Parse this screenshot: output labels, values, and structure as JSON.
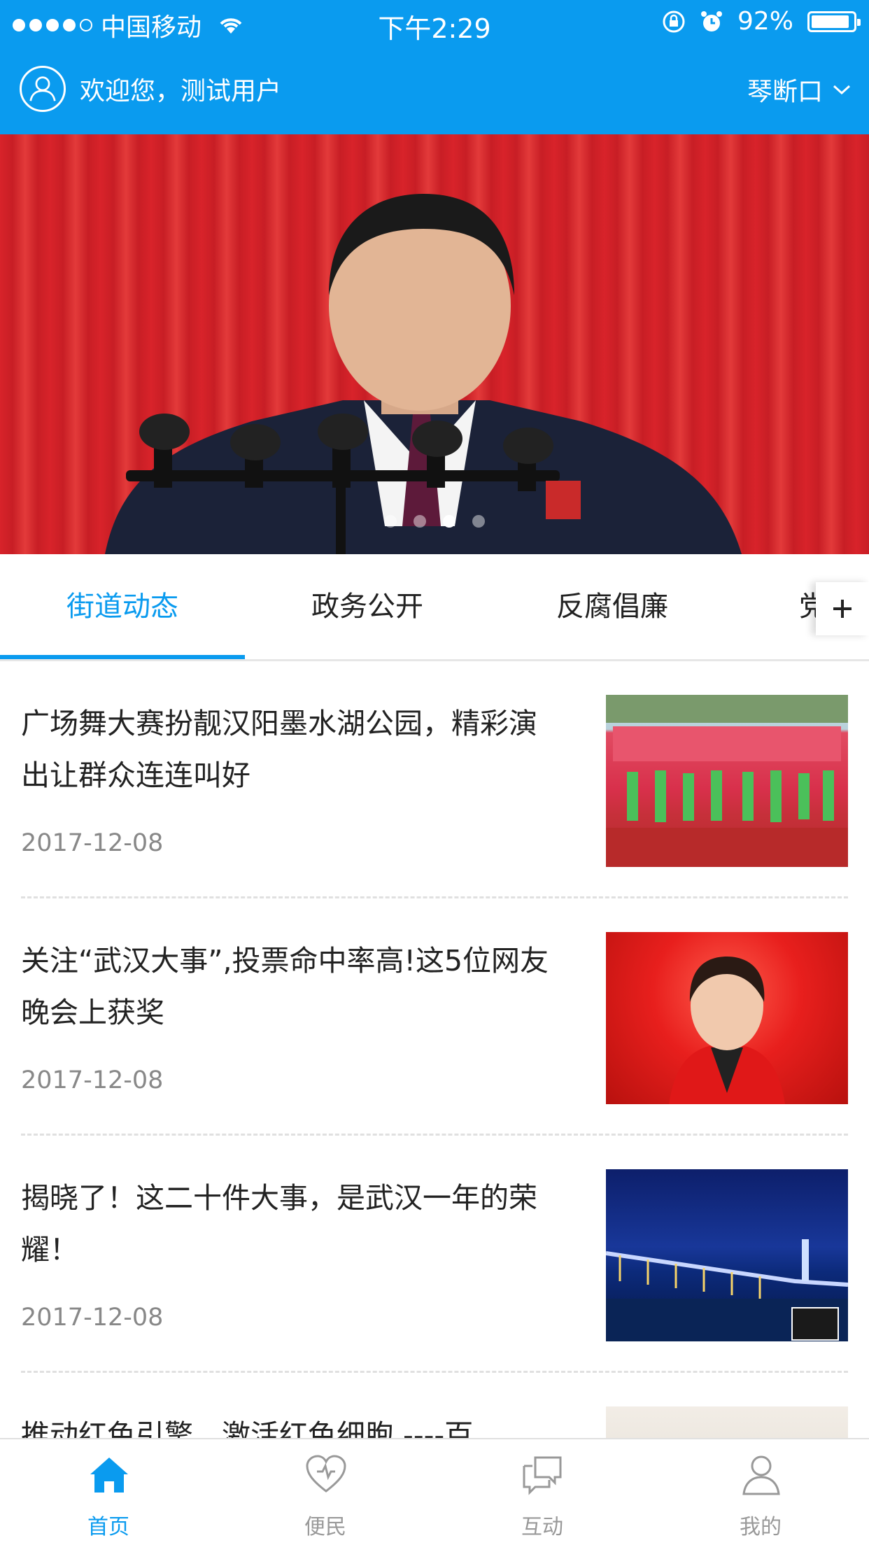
{
  "status_bar": {
    "carrier": "中国移动",
    "time": "下午2:29",
    "battery": "92%",
    "battery_level": 0.92
  },
  "header": {
    "welcome": "欢迎您，测试用户",
    "location": "琴断口"
  },
  "banner": {
    "slide_count": 4,
    "active_slide": 3
  },
  "tabs": [
    {
      "label": "街道动态",
      "active": true
    },
    {
      "label": "政务公开",
      "active": false
    },
    {
      "label": "反腐倡廉",
      "active": false
    },
    {
      "label": "党",
      "active": false
    }
  ],
  "news": [
    {
      "title": "广场舞大赛扮靓汉阳墨水湖公园，精彩演出让群众连连叫好",
      "date": "2017-12-08"
    },
    {
      "title": "关注“武汉大事”,投票命中率高!这5位网友晚会上获奖",
      "date": "2017-12-08"
    },
    {
      "title": "揭晓了！这二十件大事，是武汉一年的荣耀！",
      "date": "2017-12-08"
    },
    {
      "title": "推动红色引擎，激活红色细胞 ----百",
      "date": ""
    }
  ],
  "tabbar": [
    {
      "label": "首页",
      "icon": "home-icon",
      "active": true
    },
    {
      "label": "便民",
      "icon": "heart-icon",
      "active": false
    },
    {
      "label": "互动",
      "icon": "chat-icon",
      "active": false
    },
    {
      "label": "我的",
      "icon": "user-icon",
      "active": false
    }
  ],
  "colors": {
    "brand": "#0a9bef",
    "text": "#222222",
    "muted": "#888888"
  }
}
